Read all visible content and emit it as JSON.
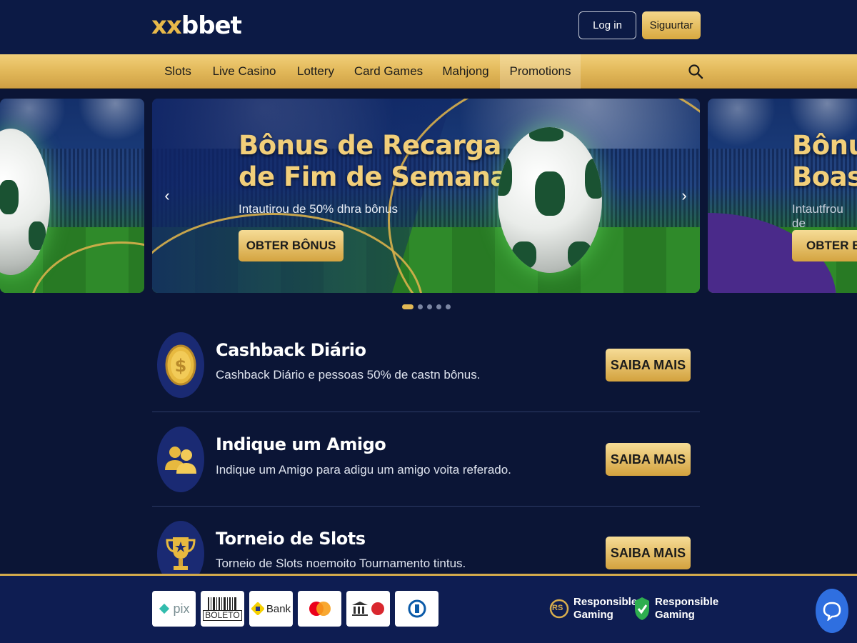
{
  "header": {
    "logo_part1": "xx",
    "logo_part2": "bbet",
    "login_label": "Log in",
    "signup_label": "Siguurtar"
  },
  "nav": {
    "items": [
      "Slots",
      "Live Casino",
      "Lottery",
      "Card Games",
      "Mahjong",
      "Promotions"
    ],
    "active": "Promotions",
    "search_icon": "search-icon"
  },
  "carousel": {
    "main": {
      "title_line1": "Bônus de Recarga",
      "title_line2": "de Fim de Semana",
      "subtitle": "Intautirou de 50% dhra bônus",
      "cta": "OBTER BÔNUS"
    },
    "next_peek": {
      "title_line1": "Bônu",
      "title_line2": "Boas",
      "subtitle": "Intautfrou de",
      "cta": "OBTER B"
    },
    "dots": 5,
    "active_dot": 0
  },
  "promotions": [
    {
      "title": "Cashback Diário",
      "description": "Cashback Diário e pessoas 50% de castn bônus.",
      "button": "SAIBA MAIS",
      "icon": "coin-dollar-icon"
    },
    {
      "title": "Indique um Amigo",
      "description": "Indique um Amigo para adigu um amigo voita referado.",
      "button": "SAIBA MAIS",
      "icon": "users-icon"
    },
    {
      "title": "Torneio de Slots",
      "description": "Torneio de Slots noemoito Tournamento tintus.",
      "button": "SAIBA MAIS",
      "icon": "trophy-icon"
    }
  ],
  "footer": {
    "payment_methods": [
      "pix",
      "BOLETO",
      "Bank",
      "mastercard",
      "bank-transfer",
      "diners-club"
    ],
    "pix_label": "pix",
    "boleto_label": "BOLETO",
    "bank_label": "Bank",
    "rg1_badge": "RS",
    "rg1_line1": "Responsible",
    "rg1_line2": "Gaming",
    "rg2_line1": "Responsible",
    "rg2_line2": "Gaming"
  },
  "colors": {
    "gold": "#e3b955",
    "navy": "#0b1536",
    "header": "#0c1a45"
  }
}
